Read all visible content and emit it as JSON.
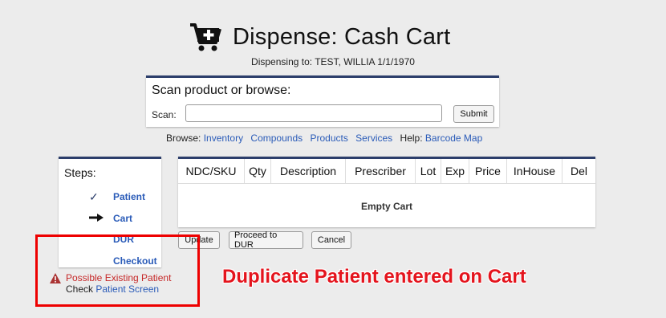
{
  "header": {
    "title": "Dispense: Cash Cart",
    "icon": "cart-plus-icon"
  },
  "dispensing_to": "Dispensing to: TEST, WILLIA 1/1/1970",
  "scan": {
    "title": "Scan product or browse:",
    "label": "Scan:",
    "input_value": "",
    "submit_label": "Submit"
  },
  "browse": {
    "prefix": "Browse:",
    "links": [
      "Inventory",
      "Compounds",
      "Products",
      "Services"
    ],
    "help_prefix": "Help:",
    "help_link": "Barcode Map"
  },
  "steps": {
    "title": "Steps:",
    "items": [
      {
        "label": "Patient",
        "status": "check-icon"
      },
      {
        "label": "Cart",
        "status": "arrow-right-icon"
      },
      {
        "label": "DUR",
        "status": ""
      },
      {
        "label": "Checkout",
        "status": ""
      }
    ]
  },
  "warning": {
    "text": "Possible Existing Patient",
    "check_prefix": "Check",
    "check_link": "Patient Screen",
    "icon": "warning-icon",
    "color": "#c62828"
  },
  "cart": {
    "columns": [
      "NDC/SKU",
      "Qty",
      "Description",
      "Prescriber",
      "Lot",
      "Exp",
      "Price",
      "InHouse",
      "Del"
    ],
    "empty_text": "Empty Cart"
  },
  "buttons": {
    "update": "Update",
    "proceed": "Proceed to DUR",
    "cancel": "Cancel"
  },
  "annotation": {
    "text": "Duplicate Patient entered on Cart",
    "color": "#e4141d"
  },
  "colors": {
    "accent": "#2c3e6b",
    "link": "#2a5bb8"
  }
}
